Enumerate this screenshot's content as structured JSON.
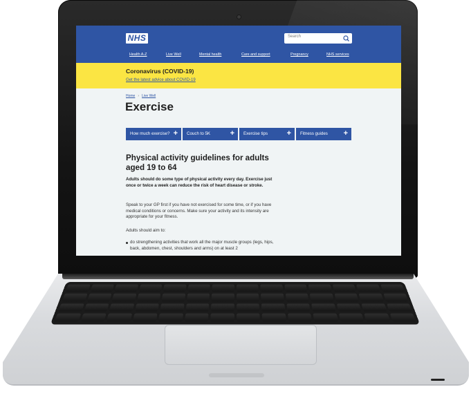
{
  "header": {
    "logo_text": "NHS",
    "search_placeholder": "Search",
    "nav": [
      "Health A-Z",
      "Live Well",
      "Mental health",
      "Care and support",
      "Pregnancy",
      "NHS services"
    ]
  },
  "alert": {
    "title": "Coronavirus (COVID-19)",
    "link": "Get the latest advice about COVID-19"
  },
  "breadcrumb": {
    "home": "Home",
    "separator": "›",
    "current": "Live Well"
  },
  "page_title": "Exercise",
  "tabs": [
    {
      "label": "How much exercise?",
      "icon": "+"
    },
    {
      "label": "Couch to 5K",
      "icon": "+"
    },
    {
      "label": "Exercise tips",
      "icon": "+"
    },
    {
      "label": "Fitness guides",
      "icon": "+"
    }
  ],
  "content": {
    "heading": "Physical activity guidelines for adults aged 19 to 64",
    "lead": "Adults should do some type of physical activity every day. Exercise just once or twice a week can reduce the risk of heart disease or stroke.",
    "para1": "Speak to your GP first if you have not exercised for some time, or if you have medical conditions or concerns. Make sure your activity and its intensity are appropriate for your fitness.",
    "para2": "Adults should aim to:",
    "list": [
      "do strengthening activities that work all the major muscle groups (legs, hips, back, abdomen, chest, shoulders and arms) on at least 2"
    ]
  },
  "colors": {
    "brand_blue": "#2f55a4",
    "alert_yellow": "#fbe543",
    "page_bg": "#f0f4f5"
  }
}
